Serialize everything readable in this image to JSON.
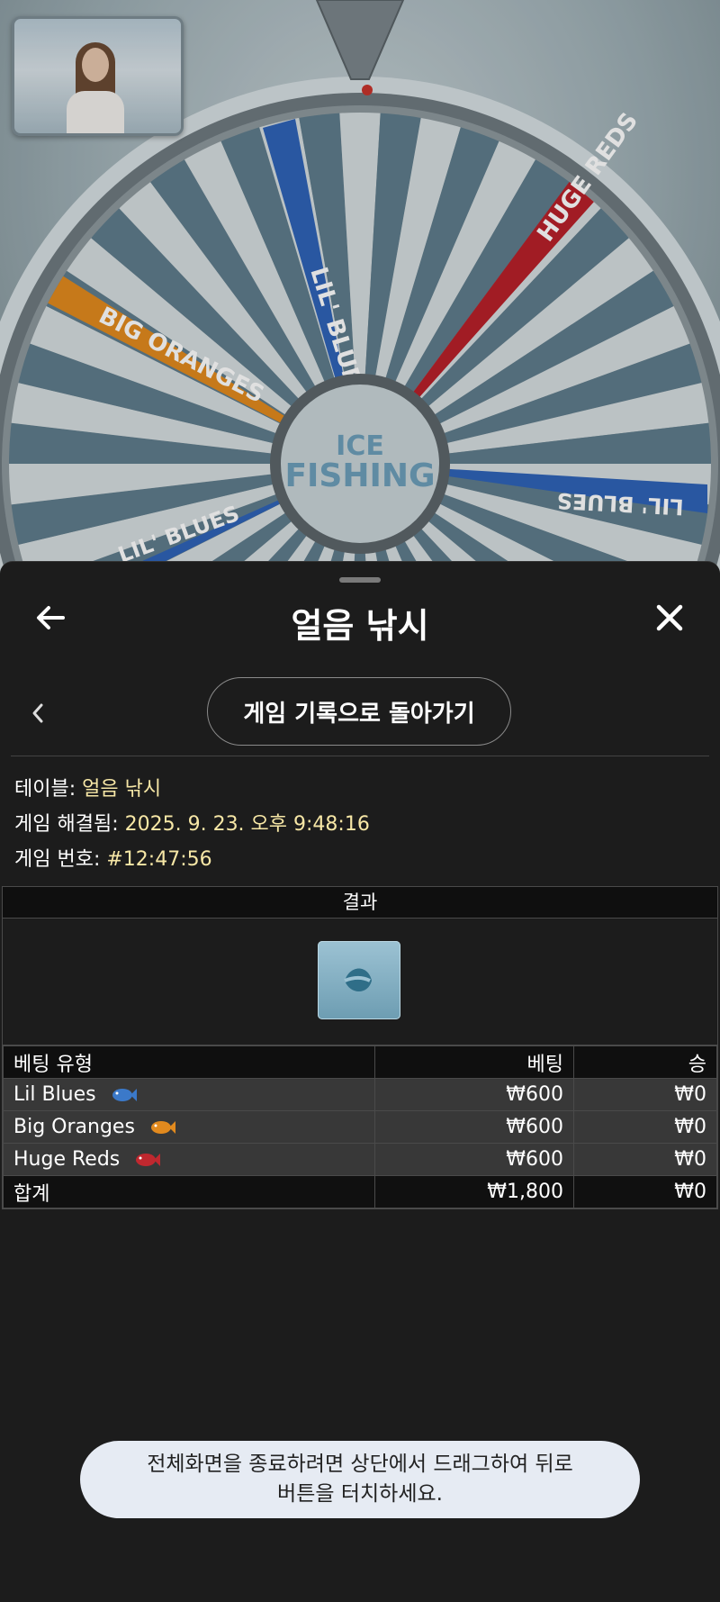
{
  "game_view": {
    "wheel_center_text": [
      "ICE",
      "FISHING"
    ],
    "segments": [
      {
        "label": "LIL' BLUES",
        "color": "#2f63b8"
      },
      {
        "label": "HUGE REDS",
        "color": "#b8202a"
      },
      {
        "label": "BIG ORANGES",
        "color": "#e28a1e"
      },
      {
        "label": "LIL' BLUES",
        "color": "#2f63b8"
      },
      {
        "label": "LIL' BLUES",
        "color": "#2f63b8"
      }
    ]
  },
  "sheet": {
    "title": "얼음 낚시",
    "history_button": "게임 기록으로 돌아가기"
  },
  "info": {
    "table_label": "테이블:",
    "table_value": "얼음 낚시",
    "resolved_label": "게임 해결됨:",
    "resolved_value": "2025. 9. 23. 오후 9:48:16",
    "game_no_label": "게임 번호:",
    "game_no_value": "#12:47:56"
  },
  "results": {
    "header": "결과",
    "columns": {
      "type": "베팅 유형",
      "bet": "베팅",
      "win": "승"
    },
    "rows": [
      {
        "type": "Lil Blues",
        "bet": "₩600",
        "win": "₩0",
        "icon": "blue-fish-icon",
        "color": "#3b79c9"
      },
      {
        "type": "Big Oranges",
        "bet": "₩600",
        "win": "₩0",
        "icon": "orange-fish-icon",
        "color": "#e28a1e"
      },
      {
        "type": "Huge Reds",
        "bet": "₩600",
        "win": "₩0",
        "icon": "red-fish-icon",
        "color": "#c0282f"
      }
    ],
    "total": {
      "type": "합계",
      "bet": "₩1,800",
      "win": "₩0"
    }
  },
  "toast": {
    "line1": "전체화면을 종료하려면 상단에서 드래그하여 뒤로",
    "line2": "버튼을 터치하세요."
  },
  "colors": {
    "sheet_bg": "#1c1c1c",
    "info_value": "#f7e7a6",
    "row_bg": "#383838",
    "header_bg": "#0f0f0f",
    "toast_bg": "#e6ebf3"
  }
}
